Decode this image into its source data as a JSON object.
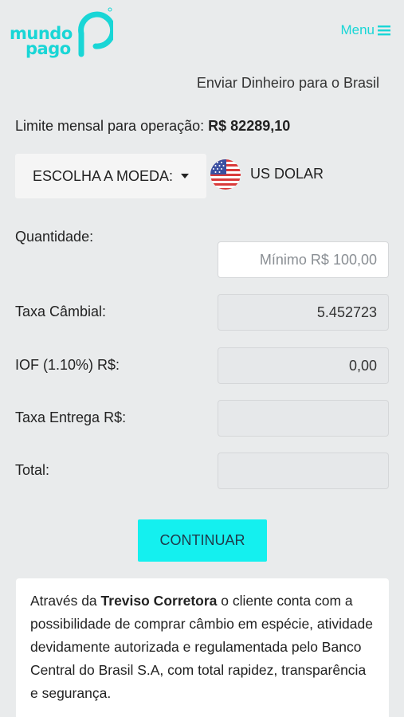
{
  "brand": {
    "line1": "mundo",
    "line2": "pago",
    "color": "#19d6d6"
  },
  "header": {
    "menu_label": "Menu",
    "menu_icon": "hamburger-icon"
  },
  "page": {
    "subtitle": "Enviar Dinheiro para o Brasil",
    "limit_label": "Limite mensal para operação:",
    "limit_value": "R$ 82289,10"
  },
  "currency": {
    "select_label": "ESCOLHA A MOEDA:",
    "selected_flag": "us-flag-icon",
    "selected_name": "US DOLAR"
  },
  "form": {
    "quantidade_label": "Quantidade:",
    "quantidade_placeholder": "Mínimo R$ 100,00",
    "quantidade_value": "",
    "taxa_cambial_label": "Taxa Câmbial:",
    "taxa_cambial_value": "5.452723",
    "iof_label": "IOF (1.10%) R$:",
    "iof_value": "0,00",
    "taxa_entrega_label": "Taxa Entrega R$:",
    "taxa_entrega_value": "",
    "total_label": "Total:",
    "total_value": ""
  },
  "actions": {
    "continue_label": "CONTINUAR",
    "accent": "#14f0ef"
  },
  "info": {
    "text_before": "Através da ",
    "company": "Treviso Corretora",
    "text_after": " o cliente conta com a possibilidade de comprar câmbio em espécie, atividade devidamente autorizada e regulamentada pelo Banco Central do Brasil S.A, com total rapidez, transparência e segurança."
  }
}
